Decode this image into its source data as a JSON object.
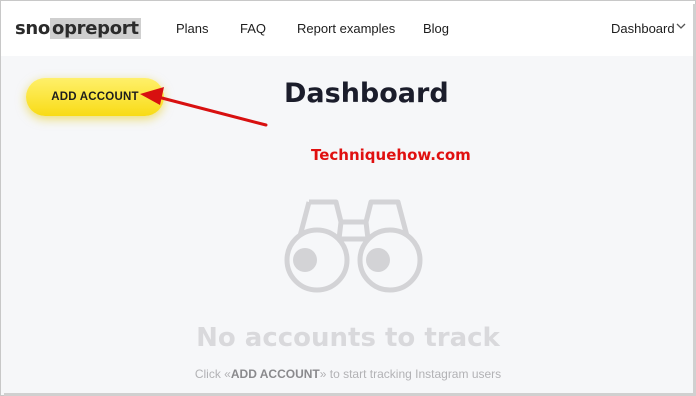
{
  "header": {
    "logo": {
      "before": "sno",
      "highlight": "opreport"
    },
    "nav": {
      "plans": "Plans",
      "faq": "FAQ",
      "reports": "Report examples",
      "blog": "Blog"
    },
    "account_menu": "Dashboard",
    "account_icon": "chevron-down-icon"
  },
  "main": {
    "add_button": "ADD ACCOUNT",
    "title": "Dashboard",
    "watermark": "Techniquehow.com",
    "annotation_icon": "red-arrow-icon",
    "empty_icon": "binoculars-icon",
    "empty_title": "No accounts to track",
    "hint": {
      "prefix": "Click «",
      "emphasis": "ADD ACCOUNT",
      "suffix": "» to start tracking Instagram users"
    }
  },
  "colors": {
    "accent": "#f8db16",
    "annotation": "#e01010",
    "background": "#f6f7f9"
  }
}
